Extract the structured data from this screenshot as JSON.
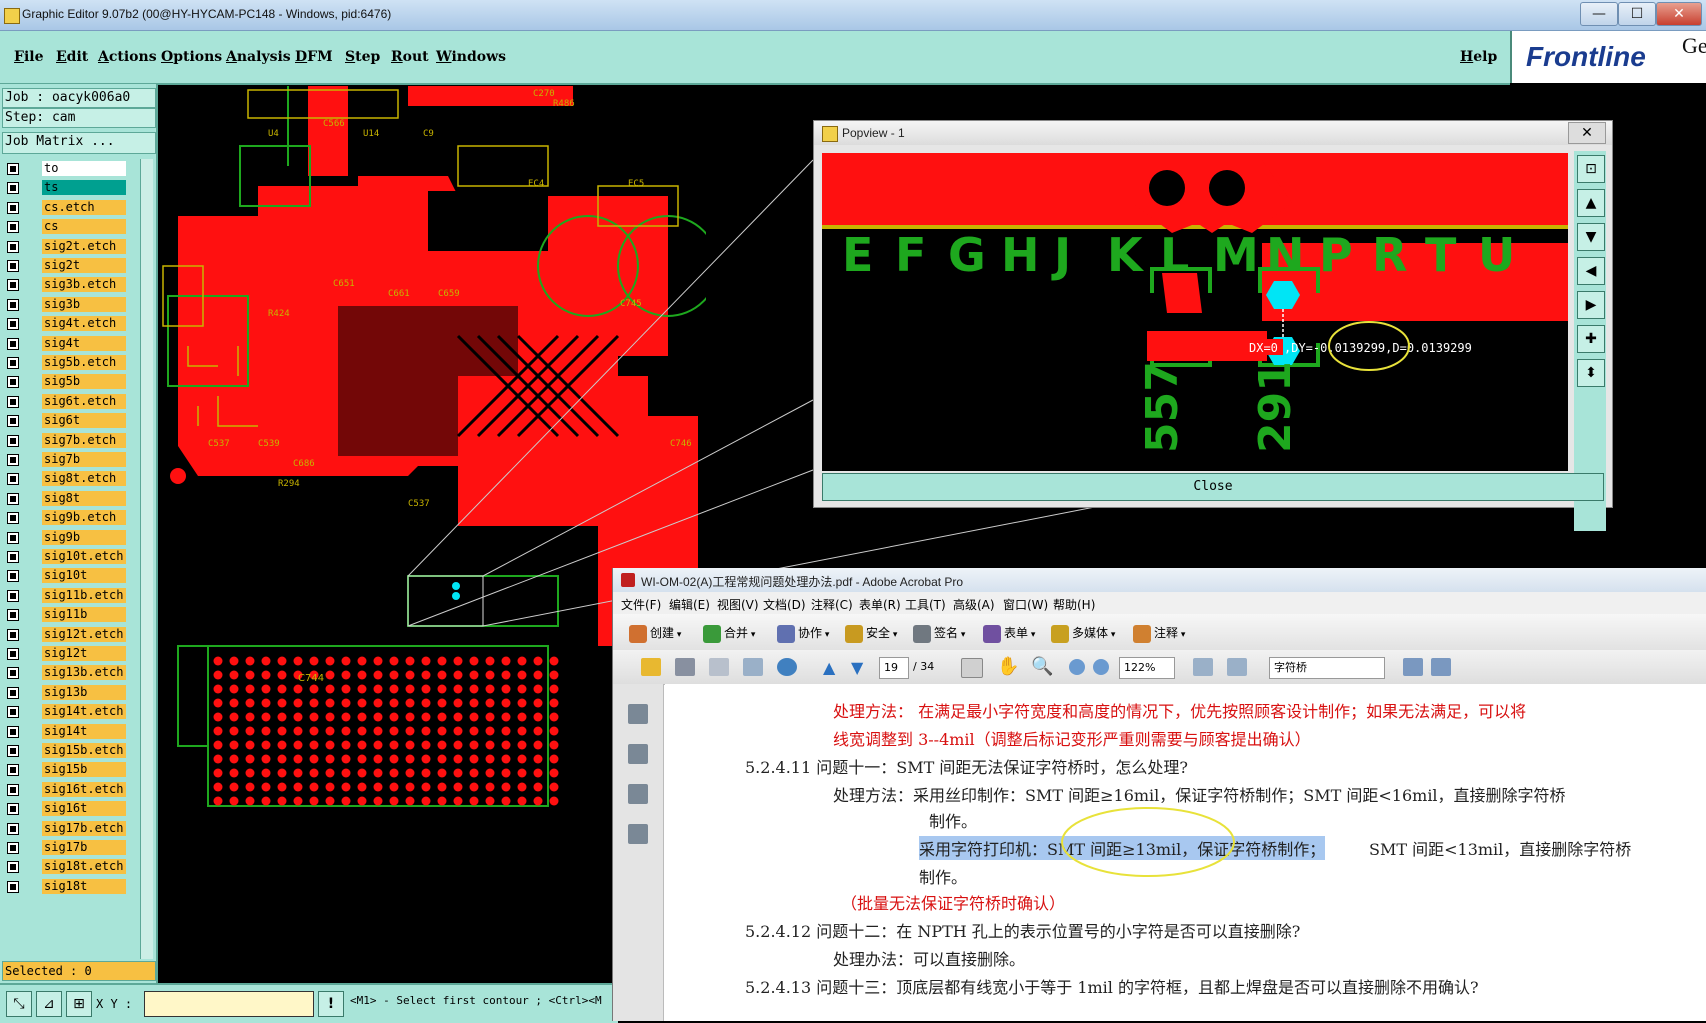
{
  "window": {
    "title": "Graphic Editor 9.07b2 (00@HY-HYCAM-PC148 - Windows, pid:6476)",
    "minimize": "—",
    "maximize": "☐",
    "close": "✕"
  },
  "menu": {
    "items": [
      "File",
      "Edit",
      "Actions",
      "Options",
      "Analysis",
      "DFM",
      "Step",
      "Rout",
      "Windows"
    ],
    "help": "Help",
    "logo": "Frontline",
    "logo_suffix": "Ge"
  },
  "left_panel": {
    "job": "Job : oacyk006a0",
    "step": "Step: cam",
    "job_matrix": "Job Matrix ...",
    "layers": [
      "to",
      "ts",
      "cs.etch",
      "cs",
      "sig2t.etch",
      "sig2t",
      "sig3b.etch",
      "sig3b",
      "sig4t.etch",
      "sig4t",
      "sig5b.etch",
      "sig5b",
      "sig6t.etch",
      "sig6t",
      "sig7b.etch",
      "sig7b",
      "sig8t.etch",
      "sig8t",
      "sig9b.etch",
      "sig9b",
      "sig10t.etch",
      "sig10t",
      "sig11b.etch",
      "sig11b",
      "sig12t.etch",
      "sig12t",
      "sig13b.etch",
      "sig13b",
      "sig14t.etch",
      "sig14t",
      "sig15b.etch",
      "sig15b",
      "sig16t.etch",
      "sig16t",
      "sig17b.etch",
      "sig17b",
      "sig18t.etch",
      "sig18t"
    ],
    "selected": "Selected : 0"
  },
  "bottom_bar": {
    "xy_label": "X Y :",
    "xy_value": "",
    "status": "<M1> - Select first contour ; <Ctrl><M"
  },
  "canvas": {
    "pcb_labels": [
      "C566",
      "C270",
      "R486",
      "U4",
      "U14",
      "C9",
      "EC4",
      "EC5",
      "C651",
      "C659",
      "C661",
      "C745",
      "R424",
      "C537",
      "C539",
      "C686",
      "R294",
      "P1",
      "C744",
      "C746"
    ]
  },
  "popview": {
    "title": "Popview - 1",
    "close_x": "✕",
    "letters": [
      "E",
      "F",
      "G",
      "H",
      "J",
      "K",
      "L",
      "M",
      "N",
      "P",
      "R",
      "T",
      "U"
    ],
    "measure_dx": "DX=0",
    "measure_rest": ",DY=-0.0139299,D=0.0139299",
    "pad_label_1": "557",
    "pad_label_2": "291",
    "close_button": "Close"
  },
  "acrobat": {
    "title": "WI-OM-02(A)工程常规问题处理办法.pdf - Adobe Acrobat Pro",
    "menu": [
      "文件(F)",
      "编辑(E)",
      "视图(V)",
      "文档(D)",
      "注释(C)",
      "表单(R)",
      "工具(T)",
      "高级(A)",
      "窗口(W)",
      "帮助(H)"
    ],
    "toolbar1": [
      "创建",
      "合并",
      "协作",
      "安全",
      "签名",
      "表单",
      "多媒体",
      "注释"
    ],
    "page_current": "19",
    "page_total": "/ 34",
    "zoom": "122%",
    "search": "字符桥",
    "lines": [
      "处理方法：   在满足最小字符宽度和高度的情况下，优先按照顾客设计制作；如果无法满足，可以将",
      "线宽调整到 3--4mil（调整后标记变形严重则需要与顾客提出确认）",
      "5.2.4.11  问题十一：SMT 间距无法保证字符桥时，怎么处理?",
      "处理方法：采用丝印制作：SMT 间距≥16mil，保证字符桥制作；SMT 间距<16mil，直接删除字符桥",
      "制作。",
      "采用字符打印机：SMT 间距≥13mil，保证字符桥制作；",
      "SMT 间距<13mil，直接删除字符桥",
      "制作。",
      "（批量无法保证字符桥时确认）",
      "5.2.4.12  问题十二：在 NPTH 孔上的表示位置号的小字符是否可以直接删除?",
      "处理办法：可以直接删除。",
      "5.2.4.13  问题十三：顶底层都有线宽小于等于 1mil 的字符框，且都上焊盘是否可以直接删除不用确认?"
    ]
  },
  "colors": {
    "pcb_red": "#ff1010",
    "silk_yellow": "#c8b400",
    "accent_teal": "#a8e4d8",
    "cyan_pad": "#00e5f5"
  }
}
